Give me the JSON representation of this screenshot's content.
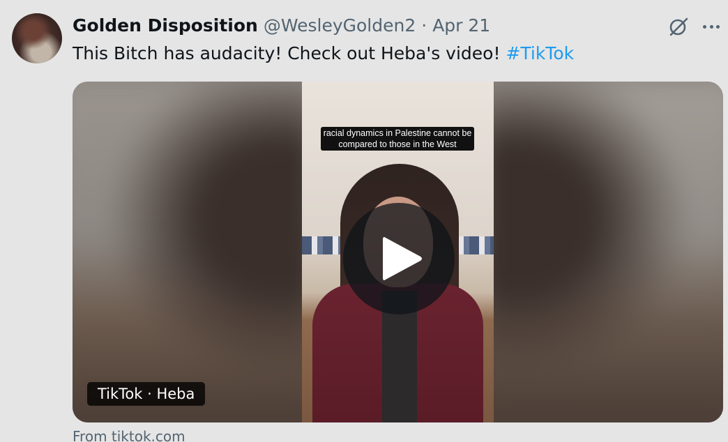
{
  "tweet": {
    "display_name": "Golden Disposition",
    "handle": "@WesleyGolden2",
    "separator": "·",
    "date": "Apr 21",
    "text_main": "This Bitch has audacity! Check out Heba's video! ",
    "hashtag": "#TikTok",
    "hashtag_color": "#1d9bf0"
  },
  "actions": {
    "grok_icon": "grok-icon",
    "more_icon": "more-icon"
  },
  "media": {
    "caption": "racial dynamics in Palestine cannot be compared to those in the West",
    "source_label": "TikTok · Heba",
    "play_icon": "play-icon"
  },
  "link_source": "From tiktok.com"
}
